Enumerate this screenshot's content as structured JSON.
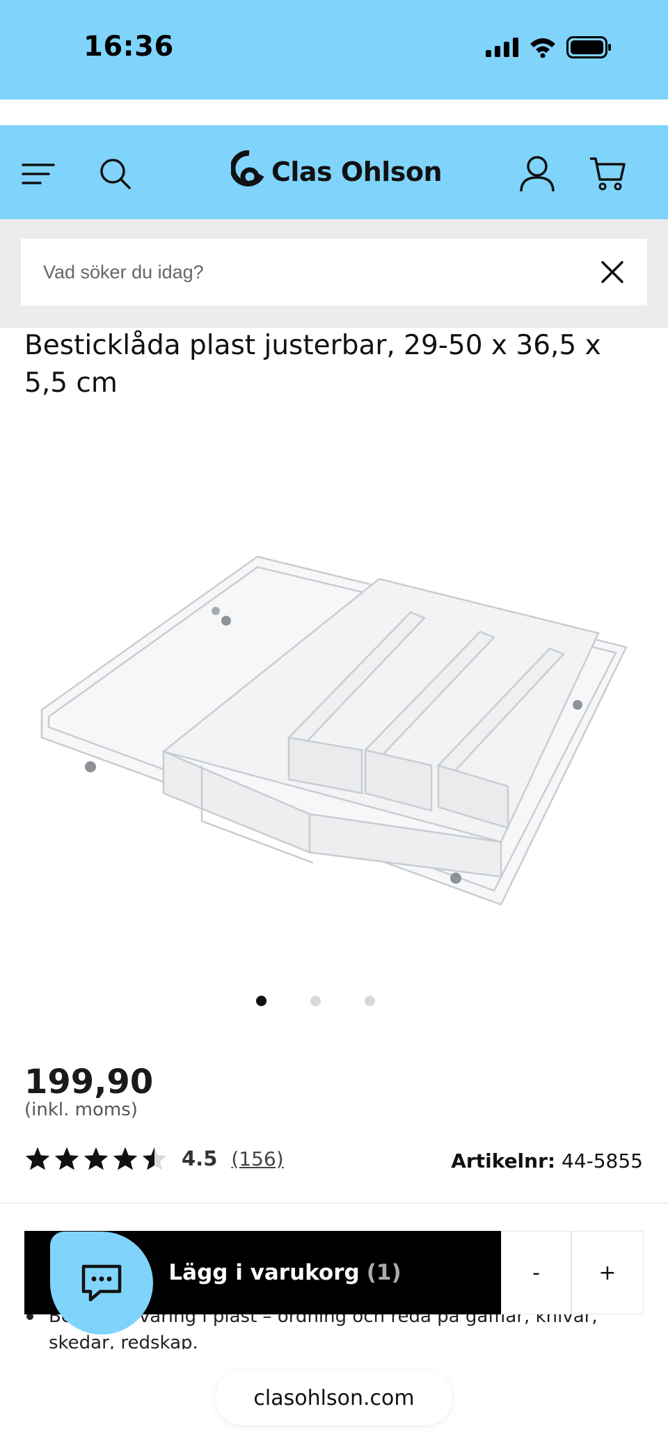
{
  "status_bar": {
    "time": "16:36",
    "icons": [
      "signal-icon",
      "wifi-icon",
      "battery-icon"
    ]
  },
  "header": {
    "logo_text": "Clas Ohlson",
    "icons": [
      "menu-icon",
      "search-icon",
      "account-icon",
      "cart-icon"
    ]
  },
  "search": {
    "placeholder": "Vad söker du idag?"
  },
  "product": {
    "title": "Besticklåda plast justerbar, 29-50 x 36,5 x 5,5 cm",
    "image_count": 3,
    "active_image": 1,
    "price": "199,90",
    "price_note": "(inkl. moms)",
    "rating": 4.5,
    "rating_label": "4.5",
    "review_count": "(156)",
    "article_label": "Artikelnr:",
    "article_number": "44-5855"
  },
  "cart": {
    "add_label": "Lägg i varukorg",
    "count_label": "(1)",
    "minus_label": "-",
    "plus_label": "+"
  },
  "description": {
    "text": "Bestickförvaring i plast – ordning och reda på gafflar, knivar, skedar, redskap."
  },
  "browser": {
    "url": "clasohlson.com"
  },
  "colors": {
    "brand_blue": "#80d4fb",
    "button_black": "#000000"
  }
}
